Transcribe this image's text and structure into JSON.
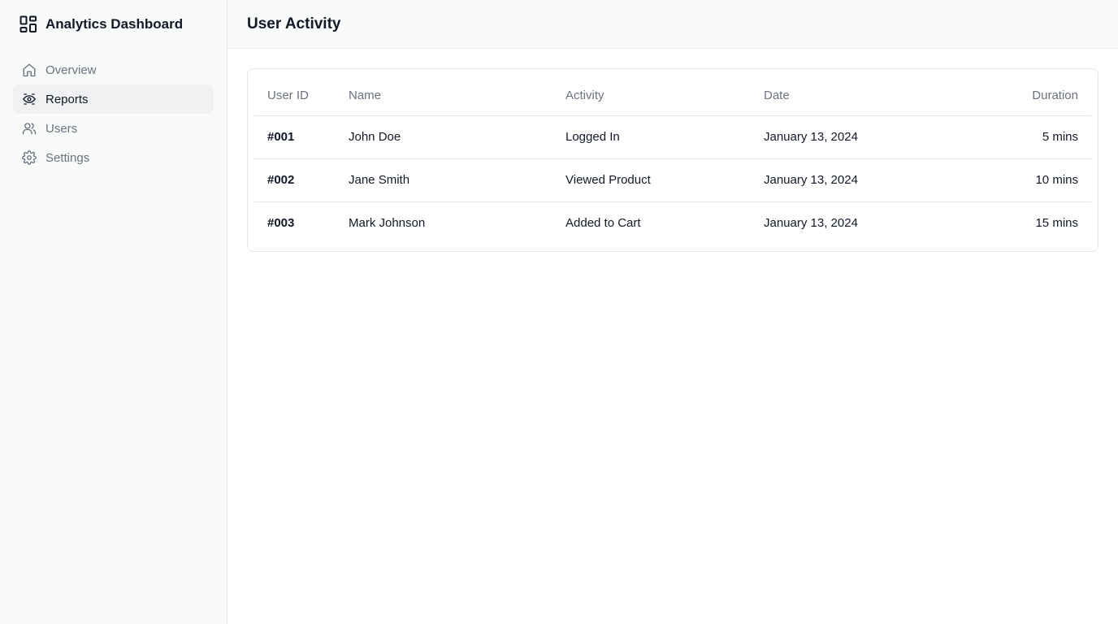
{
  "app": {
    "title": "Analytics Dashboard",
    "logo_icon": "dashboard-grid-icon"
  },
  "sidebar": {
    "items": [
      {
        "label": "Overview",
        "icon": "home-icon",
        "active": false
      },
      {
        "label": "Reports",
        "icon": "eye-icon",
        "active": true
      },
      {
        "label": "Users",
        "icon": "users-icon",
        "active": false
      },
      {
        "label": "Settings",
        "icon": "gear-icon",
        "active": false
      }
    ]
  },
  "header": {
    "title": "User Activity"
  },
  "table": {
    "columns": [
      "User ID",
      "Name",
      "Activity",
      "Date",
      "Duration"
    ],
    "rows": [
      {
        "id": "#001",
        "name": "John Doe",
        "activity": "Logged In",
        "date": "January 13, 2024",
        "duration": "5 mins"
      },
      {
        "id": "#002",
        "name": "Jane Smith",
        "activity": "Viewed Product",
        "date": "January 13, 2024",
        "duration": "10 mins"
      },
      {
        "id": "#003",
        "name": "Mark Johnson",
        "activity": "Added to Cart",
        "date": "January 13, 2024",
        "duration": "15 mins"
      }
    ]
  },
  "colors": {
    "sidebar_bg": "#f9fafa",
    "active_item_bg": "#f0f1f3",
    "border": "#e5e7eb",
    "muted_text": "#6b7280",
    "text": "#111827"
  }
}
